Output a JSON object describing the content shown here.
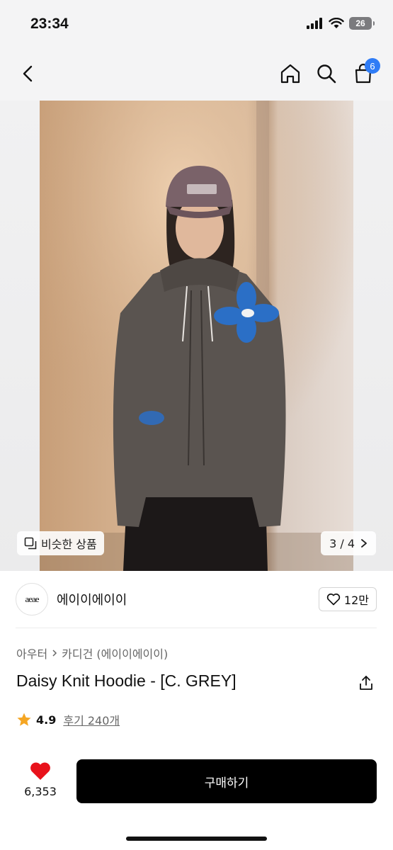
{
  "status": {
    "time": "23:34",
    "battery": "26"
  },
  "nav": {
    "cart_count": "6"
  },
  "hero": {
    "similar_label": "비슷한 상품",
    "pager": "3 / 4"
  },
  "brand": {
    "logo_text": "aeae",
    "name": "에이이에이이",
    "like_count": "12만"
  },
  "breadcrumb": {
    "category": "아우터",
    "subcategory": "카디건 (에이이에이이)"
  },
  "product": {
    "title": "Daisy Knit Hoodie - [C. GREY]"
  },
  "rating": {
    "value": "4.9",
    "reviews": "후기 240개"
  },
  "bottom": {
    "wish_count": "6,353",
    "buy_label": "구매하기"
  },
  "colors": {
    "accent_blue": "#2f7cf6",
    "star": "#f5a623",
    "heart": "#e8121b",
    "buy_bg": "#000000"
  }
}
